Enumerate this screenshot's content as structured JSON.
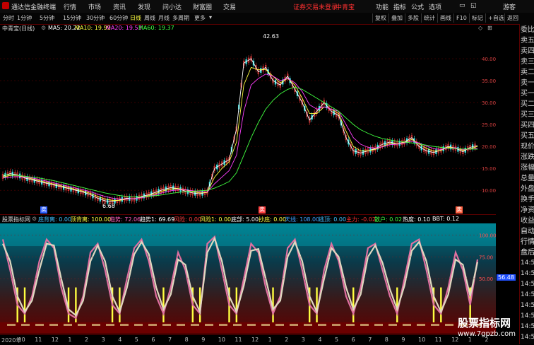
{
  "titlebar": {
    "app_title": "通达信金融终端",
    "menus": [
      "行情",
      "市场",
      "资讯",
      "发现",
      "问小达",
      "财富圈",
      "交易"
    ],
    "login_status": "证券交易未登录",
    "stock_name": "中青宝",
    "right_menus": [
      "功能",
      "指标",
      "公式",
      "选项"
    ],
    "guest": "游客",
    "accent": "#ff3030"
  },
  "toolbar": {
    "periods": [
      "分时",
      "1分钟",
      "5分钟",
      "15分钟",
      "30分钟",
      "60分钟",
      "日线",
      "周线",
      "月线",
      "多周期",
      "更多"
    ],
    "active_period": "日线",
    "right_buttons": [
      "复权",
      "叠加",
      "多股",
      "统计",
      "画线",
      "F10",
      "标记",
      "+自选",
      "返回"
    ]
  },
  "chart_header": {
    "title": "中青宝(日线)",
    "ma_items": [
      {
        "label": "MA5: 20.22",
        "color": "#ffffff"
      },
      {
        "label": "MA10: 19.99",
        "color": "#ffff40"
      },
      {
        "label": "MA20: 19.53",
        "color": "#ff40ff"
      },
      {
        "label": "MA60: 19.37",
        "color": "#40ff40"
      }
    ]
  },
  "sub_header": {
    "title": "股票指标网",
    "items": [
      {
        "label": "底背离: 0.00",
        "color": "#40c0ff"
      },
      {
        "label": "顶背离: 100.00",
        "color": "#ffff40"
      },
      {
        "label": "趋势: 72.06",
        "color": "#ff60c0"
      },
      {
        "label": "趋势1: 69.69",
        "color": "#ffffff"
      },
      {
        "label": "风险: 0.00",
        "color": "#ff4040"
      },
      {
        "label": "风险1: 0.00",
        "color": "#ffff40"
      },
      {
        "label": "底部: 5.00",
        "color": "#ffffff"
      },
      {
        "label": "抄底: 0.00",
        "color": "#ffff40"
      },
      {
        "label": "天线: 108.00",
        "color": "#40a0ff"
      },
      {
        "label": "逃顶: 0.00",
        "color": "#40c0ff"
      },
      {
        "label": "主力: -0.02",
        "color": "#ff3030"
      },
      {
        "label": "散户: 0.02",
        "color": "#40ff40"
      },
      {
        "label": "热度: 0.10",
        "color": "#ffffff"
      },
      {
        "label": "BBT: 0.12",
        "color": "#ffffff"
      }
    ]
  },
  "side_panel": {
    "items": [
      "委比",
      "卖五",
      "卖四",
      "卖三",
      "卖二",
      "卖一",
      "买一",
      "买二",
      "买三",
      "买四",
      "买五",
      "现价",
      "涨跌",
      "涨幅",
      "总量",
      "外盘",
      "换手",
      "净资",
      "收益",
      "自动",
      "行情",
      "盘后",
      "14:5",
      "14:5",
      "14:5",
      "14:5",
      "14:5",
      "14:5",
      "14:5",
      "14:5"
    ]
  },
  "markers": {
    "sell_left": "卖",
    "sell_mid": "卖",
    "sell_right": "卖"
  },
  "date_axis": [
    "2020年",
    "10",
    "11",
    "12",
    "1",
    "2",
    "3",
    "4",
    "5",
    "6",
    "7",
    "8",
    "9",
    "10",
    "11",
    "12",
    "1",
    "2",
    "3",
    "4",
    "5",
    "6",
    "7",
    "8",
    "9",
    "10",
    "11",
    "12",
    "1",
    "2"
  ],
  "watermark": {
    "line1": "股票指标网",
    "line2": "www.7gpzb.com"
  },
  "chart_data": [
    {
      "type": "line",
      "title": "中青宝(日线)",
      "ylim": [
        6,
        45
      ],
      "y_ticks": [
        10.0,
        15.0,
        20.0,
        25.0,
        30.0,
        35.0,
        40.0
      ],
      "annotations": [
        {
          "label": "42.63"
        },
        {
          "label": "6.68"
        }
      ],
      "series": [
        {
          "name": "MA5",
          "color": "#ffffff",
          "values": [
            13.2,
            13.8,
            13.5,
            12.8,
            12.4,
            12.0,
            11.6,
            11.2,
            10.8,
            10.4,
            10.0,
            9.6,
            9.0,
            8.2,
            7.6,
            7.4,
            7.8,
            8.2,
            8.0,
            8.6,
            9.0,
            9.6,
            10.2,
            10.6,
            10.4,
            9.8,
            9.4,
            9.2,
            9.6,
            15.0,
            16.0,
            17.0,
            24.0,
            39.0,
            40.0,
            37.0,
            38.0,
            35.0,
            34.0,
            36.0,
            33.0,
            30.0,
            26.0,
            28.0,
            30.0,
            28.0,
            27.0,
            22.0,
            19.0,
            18.5,
            19.0,
            19.5,
            20.5,
            21.0,
            20.6,
            21.0,
            22.0,
            20.0,
            19.0,
            18.6,
            19.2,
            20.0,
            19.6,
            18.8,
            19.8,
            20.2
          ]
        },
        {
          "name": "MA10",
          "color": "#ffff40",
          "values": [
            13.0,
            13.4,
            13.4,
            13.0,
            12.6,
            12.2,
            11.8,
            11.4,
            11.0,
            10.6,
            10.2,
            9.8,
            9.3,
            8.6,
            8.0,
            7.7,
            7.7,
            8.0,
            8.1,
            8.4,
            8.8,
            9.3,
            9.9,
            10.3,
            10.4,
            10.1,
            9.7,
            9.4,
            9.5,
            13.0,
            15.0,
            16.5,
            21.0,
            34.0,
            38.0,
            37.5,
            37.5,
            36.0,
            34.5,
            35.5,
            34.0,
            31.0,
            27.5,
            27.5,
            29.0,
            28.5,
            27.5,
            23.5,
            20.0,
            19.0,
            19.0,
            19.3,
            20.0,
            20.7,
            20.6,
            20.9,
            21.6,
            20.6,
            19.6,
            18.9,
            19.1,
            19.8,
            19.7,
            19.1,
            19.5,
            19.99
          ]
        },
        {
          "name": "MA20",
          "color": "#ff40ff",
          "values": [
            12.8,
            13.0,
            13.1,
            13.0,
            12.8,
            12.5,
            12.1,
            11.7,
            11.3,
            10.9,
            10.5,
            10.1,
            9.7,
            9.1,
            8.6,
            8.2,
            8.0,
            8.0,
            8.1,
            8.3,
            8.6,
            9.0,
            9.5,
            9.9,
            10.1,
            10.1,
            9.9,
            9.7,
            9.6,
            11.5,
            13.0,
            14.5,
            18.0,
            28.0,
            34.0,
            35.5,
            36.5,
            36.0,
            35.0,
            35.5,
            34.5,
            32.5,
            29.5,
            28.5,
            29.0,
            28.5,
            28.0,
            25.0,
            22.0,
            20.5,
            19.8,
            19.6,
            19.9,
            20.4,
            20.5,
            20.8,
            21.2,
            20.8,
            20.1,
            19.5,
            19.3,
            19.6,
            19.7,
            19.3,
            19.4,
            19.53
          ]
        },
        {
          "name": "MA60",
          "color": "#40ff40",
          "values": [
            13.5,
            13.5,
            13.4,
            13.2,
            13.0,
            12.8,
            12.5,
            12.2,
            11.8,
            11.4,
            11.0,
            10.6,
            10.2,
            9.8,
            9.4,
            9.1,
            8.8,
            8.6,
            8.5,
            8.5,
            8.6,
            8.8,
            9.0,
            9.3,
            9.5,
            9.7,
            9.8,
            9.9,
            10.0,
            10.5,
            11.2,
            12.0,
            14.0,
            18.0,
            22.0,
            25.5,
            28.5,
            30.5,
            32.0,
            33.0,
            33.5,
            33.0,
            32.0,
            31.0,
            30.0,
            29.0,
            28.0,
            26.5,
            25.0,
            23.8,
            23.0,
            22.3,
            21.8,
            21.5,
            21.2,
            21.0,
            20.8,
            20.6,
            20.3,
            20.0,
            19.8,
            19.6,
            19.5,
            19.4,
            19.4,
            19.37
          ]
        }
      ]
    },
    {
      "type": "line",
      "title": "股票指标网",
      "ylim": [
        0,
        110
      ],
      "y_ticks": [
        50.0,
        75.0,
        100.0
      ],
      "current_label": "56.48",
      "series": [
        {
          "name": "趋势",
          "color": "#e070a0",
          "values": [
            95,
            60,
            20,
            10,
            30,
            70,
            95,
            85,
            40,
            10,
            5,
            30,
            80,
            90,
            60,
            20,
            10,
            50,
            85,
            95,
            70,
            30,
            10,
            40,
            80,
            60,
            20,
            10,
            90,
            98,
            60,
            20,
            10,
            50,
            90,
            80,
            40,
            10,
            30,
            85,
            95,
            60,
            20,
            10,
            60,
            90,
            70,
            30,
            10,
            40,
            85,
            90,
            60,
            30,
            10,
            50,
            90,
            95,
            60,
            20,
            10,
            40,
            80,
            60,
            20,
            72
          ]
        },
        {
          "name": "趋势1",
          "color": "#e0d8c0",
          "values": [
            90,
            70,
            30,
            12,
            25,
            60,
            90,
            88,
            50,
            15,
            8,
            25,
            70,
            88,
            70,
            30,
            12,
            40,
            78,
            92,
            78,
            40,
            15,
            32,
            72,
            66,
            30,
            12,
            80,
            96,
            70,
            30,
            12,
            42,
            82,
            84,
            50,
            15,
            25,
            75,
            92,
            70,
            30,
            12,
            50,
            85,
            75,
            40,
            15,
            32,
            75,
            88,
            68,
            38,
            15,
            42,
            82,
            92,
            70,
            30,
            12,
            32,
            72,
            66,
            30,
            69
          ]
        }
      ]
    }
  ]
}
